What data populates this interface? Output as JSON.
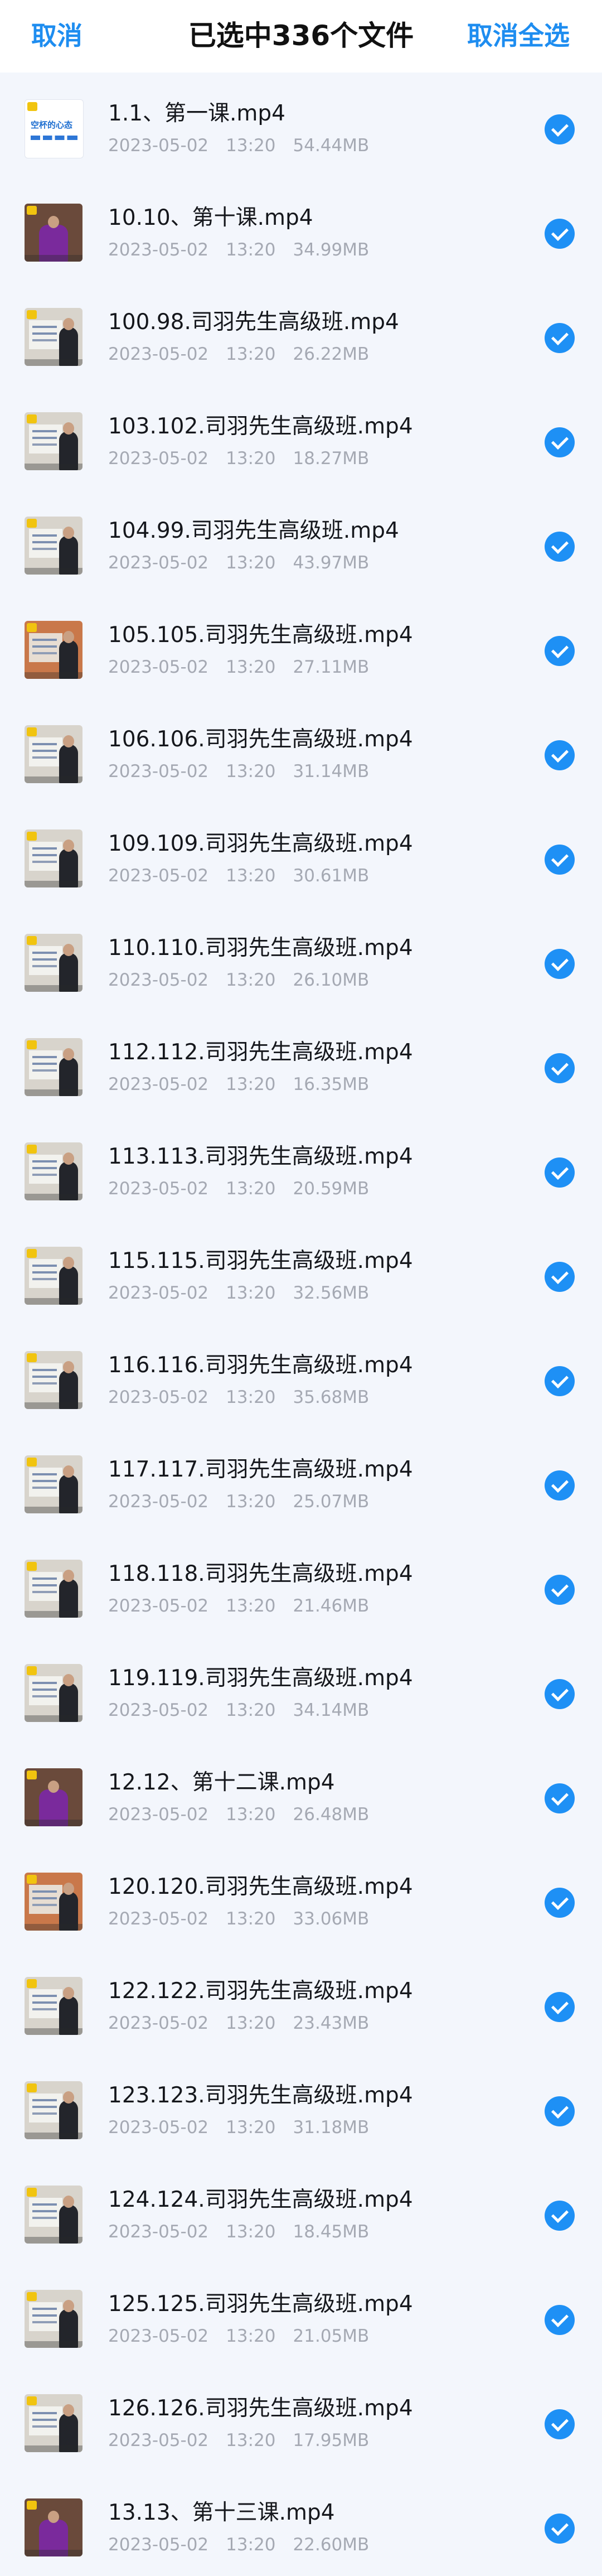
{
  "header": {
    "cancel_label": "取消",
    "title": "已选中336个文件",
    "deselect_all_label": "取消全选"
  },
  "colors": {
    "accent": "#1e8df0",
    "background": "#f3f6fc"
  },
  "files": [
    {
      "name": "1.1、第一课.mp4",
      "date": "2023-05-02",
      "time": "13:20",
      "size": "54.44MB",
      "thumb": "title-card",
      "thumb_text": "空杯的心态",
      "checked": true
    },
    {
      "name": "10.10、第十课.mp4",
      "date": "2023-05-02",
      "time": "13:20",
      "size": "34.99MB",
      "thumb": "speaker",
      "checked": true
    },
    {
      "name": "100.98.司羽先生高级班.mp4",
      "date": "2023-05-02",
      "time": "13:20",
      "size": "26.22MB",
      "thumb": "board",
      "checked": true
    },
    {
      "name": "103.102.司羽先生高级班.mp4",
      "date": "2023-05-02",
      "time": "13:20",
      "size": "18.27MB",
      "thumb": "board",
      "checked": true
    },
    {
      "name": "104.99.司羽先生高级班.mp4",
      "date": "2023-05-02",
      "time": "13:20",
      "size": "43.97MB",
      "thumb": "board",
      "checked": true
    },
    {
      "name": "105.105.司羽先生高级班.mp4",
      "date": "2023-05-02",
      "time": "13:20",
      "size": "27.11MB",
      "thumb": "orange",
      "checked": true
    },
    {
      "name": "106.106.司羽先生高级班.mp4",
      "date": "2023-05-02",
      "time": "13:20",
      "size": "31.14MB",
      "thumb": "board",
      "checked": true
    },
    {
      "name": "109.109.司羽先生高级班.mp4",
      "date": "2023-05-02",
      "time": "13:20",
      "size": "30.61MB",
      "thumb": "board",
      "checked": true
    },
    {
      "name": "110.110.司羽先生高级班.mp4",
      "date": "2023-05-02",
      "time": "13:20",
      "size": "26.10MB",
      "thumb": "board",
      "checked": true
    },
    {
      "name": "112.112.司羽先生高级班.mp4",
      "date": "2023-05-02",
      "time": "13:20",
      "size": "16.35MB",
      "thumb": "board",
      "checked": true
    },
    {
      "name": "113.113.司羽先生高级班.mp4",
      "date": "2023-05-02",
      "time": "13:20",
      "size": "20.59MB",
      "thumb": "board",
      "checked": true
    },
    {
      "name": "115.115.司羽先生高级班.mp4",
      "date": "2023-05-02",
      "time": "13:20",
      "size": "32.56MB",
      "thumb": "board",
      "checked": true
    },
    {
      "name": "116.116.司羽先生高级班.mp4",
      "date": "2023-05-02",
      "time": "13:20",
      "size": "35.68MB",
      "thumb": "board",
      "checked": true
    },
    {
      "name": "117.117.司羽先生高级班.mp4",
      "date": "2023-05-02",
      "time": "13:20",
      "size": "25.07MB",
      "thumb": "board",
      "checked": true
    },
    {
      "name": "118.118.司羽先生高级班.mp4",
      "date": "2023-05-02",
      "time": "13:20",
      "size": "21.46MB",
      "thumb": "board",
      "checked": true
    },
    {
      "name": "119.119.司羽先生高级班.mp4",
      "date": "2023-05-02",
      "time": "13:20",
      "size": "34.14MB",
      "thumb": "board",
      "checked": true
    },
    {
      "name": "12.12、第十二课.mp4",
      "date": "2023-05-02",
      "time": "13:20",
      "size": "26.48MB",
      "thumb": "speaker",
      "checked": true
    },
    {
      "name": "120.120.司羽先生高级班.mp4",
      "date": "2023-05-02",
      "time": "13:20",
      "size": "33.06MB",
      "thumb": "orange",
      "checked": true
    },
    {
      "name": "122.122.司羽先生高级班.mp4",
      "date": "2023-05-02",
      "time": "13:20",
      "size": "23.43MB",
      "thumb": "board",
      "checked": true
    },
    {
      "name": "123.123.司羽先生高级班.mp4",
      "date": "2023-05-02",
      "time": "13:20",
      "size": "31.18MB",
      "thumb": "board",
      "checked": true
    },
    {
      "name": "124.124.司羽先生高级班.mp4",
      "date": "2023-05-02",
      "time": "13:20",
      "size": "18.45MB",
      "thumb": "board",
      "checked": true
    },
    {
      "name": "125.125.司羽先生高级班.mp4",
      "date": "2023-05-02",
      "time": "13:20",
      "size": "21.05MB",
      "thumb": "board",
      "checked": true
    },
    {
      "name": "126.126.司羽先生高级班.mp4",
      "date": "2023-05-02",
      "time": "13:20",
      "size": "17.95MB",
      "thumb": "board",
      "checked": true
    },
    {
      "name": "13.13、第十三课.mp4",
      "date": "2023-05-02",
      "time": "13:20",
      "size": "22.60MB",
      "thumb": "speaker",
      "checked": true
    }
  ]
}
